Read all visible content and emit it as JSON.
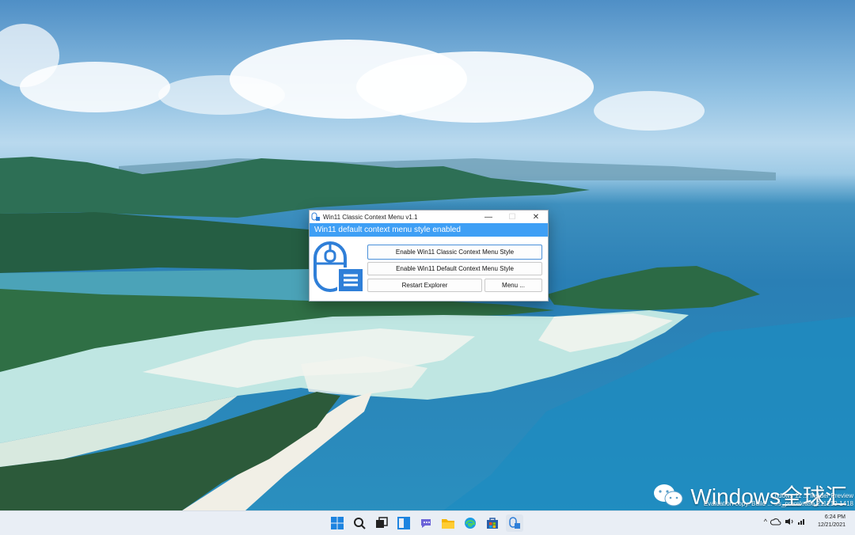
{
  "window": {
    "title": "Win11 Classic Context Menu v1.1",
    "minimize": "—",
    "maximize": "☐",
    "close": "✕",
    "status": "Win11 default context menu style enabled"
  },
  "buttons": {
    "enable_classic": "Enable Win11 Classic Context Menu Style",
    "enable_default": "Enable Win11 Default Context Menu Style",
    "restart_explorer": "Restart Explorer",
    "menu": "Menu ..."
  },
  "watermark": {
    "text": "Windows全球汇",
    "eval_line1": "...ndows 11 ... Insider Preview",
    "eval_line2": "Evaluation copy. Build ... .rs_prerelease.211210-1418"
  },
  "taskbar": {
    "icons": [
      "windows-start-icon",
      "search-icon",
      "task-view-icon",
      "widgets-icon",
      "chat-icon",
      "file-explorer-icon",
      "edge-icon",
      "store-icon",
      "context-menu-app-icon"
    ],
    "tray": {
      "chevron": "^",
      "time": "6:24 PM",
      "date": "12/21/2021"
    }
  },
  "colors": {
    "status_bar": "#3e9ff5",
    "icon_blue": "#2f7fd8",
    "focus_border": "#4a90d9"
  }
}
